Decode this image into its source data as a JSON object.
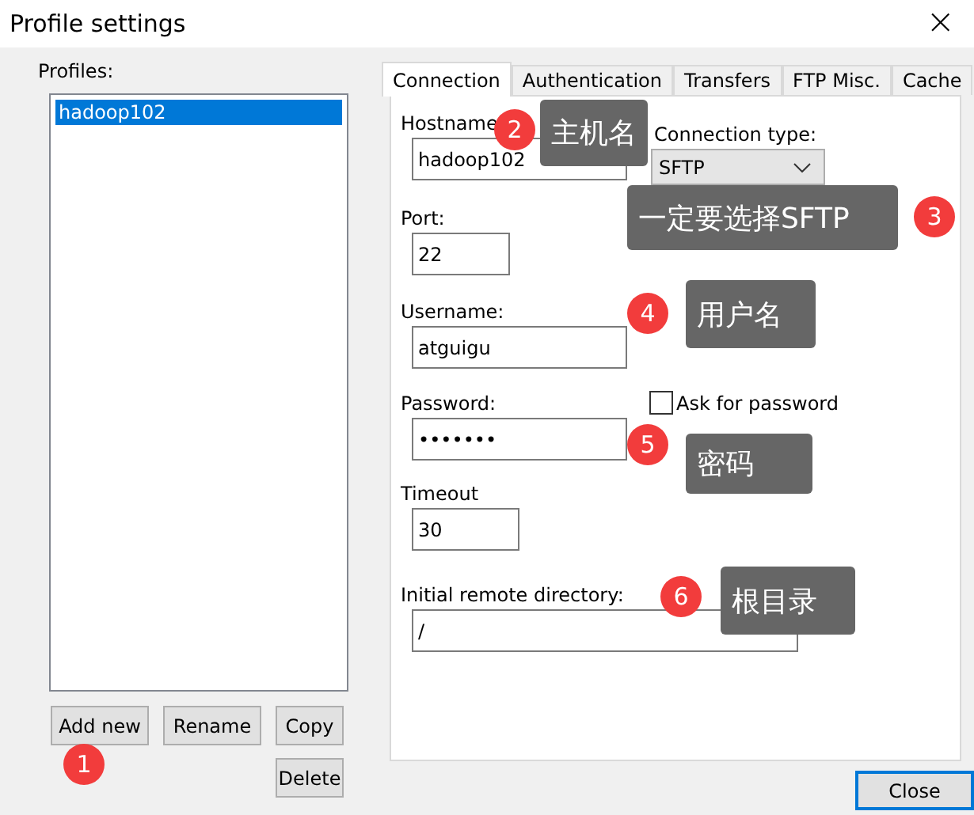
{
  "window": {
    "title": "Profile settings",
    "close": "×"
  },
  "profiles": {
    "label": "Profiles:",
    "items": [
      {
        "name": "hadoop102",
        "selected": true
      }
    ]
  },
  "profile_buttons": [
    "Add new",
    "Rename",
    "Copy",
    "Delete"
  ],
  "tabs": [
    {
      "label": "Connection",
      "selected": true
    },
    {
      "label": "Authentication",
      "selected": false
    },
    {
      "label": "Transfers",
      "selected": false
    },
    {
      "label": "FTP Misc.",
      "selected": false
    },
    {
      "label": "Cache",
      "selected": false
    }
  ],
  "connection": {
    "hostname": {
      "label": "Hostname",
      "value": "hadoop102"
    },
    "connection_type": {
      "label": "Connection type:",
      "value": "SFTP"
    },
    "port": {
      "label": "Port:",
      "value": "22"
    },
    "username": {
      "label": "Username:",
      "value": "atguigu"
    },
    "password": {
      "label": "Password:",
      "value": "•••••••"
    },
    "ask_for_password": {
      "label": "Ask for password",
      "checked": false
    },
    "timeout": {
      "label": "Timeout",
      "value": "30"
    },
    "initial_remote_directory": {
      "label": "Initial remote directory:",
      "value": "/"
    }
  },
  "close_button": "Close",
  "annotations": [
    {
      "number": "1"
    },
    {
      "number": "2",
      "text": "主机名"
    },
    {
      "number": "3",
      "text": "一定要选择SFTP"
    },
    {
      "number": "4",
      "text": "用户名"
    },
    {
      "number": "5",
      "text": "密码"
    },
    {
      "number": "6",
      "text": "根目录"
    }
  ]
}
